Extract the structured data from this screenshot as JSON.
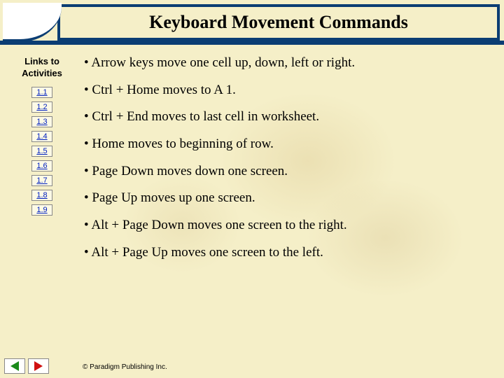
{
  "title": "Keyboard Movement Commands",
  "sidebar": {
    "heading_l1": "Links to",
    "heading_l2": "Activities",
    "links": [
      "1.1",
      "1.2",
      "1.3",
      "1.4",
      "1.5",
      "1.6",
      "1.7",
      "1.8",
      "1.9"
    ]
  },
  "bullets": [
    "• Arrow keys move one cell up, down, left or right.",
    "• Ctrl + Home moves to A 1.",
    "• Ctrl + End moves to last cell in worksheet.",
    "• Home moves to beginning of row.",
    "• Page Down moves down one screen.",
    "• Page Up moves up one screen.",
    "• Alt + Page Down moves one screen to the right.",
    "• Alt + Page Up moves one screen to the left."
  ],
  "footer": "© Paradigm Publishing Inc."
}
